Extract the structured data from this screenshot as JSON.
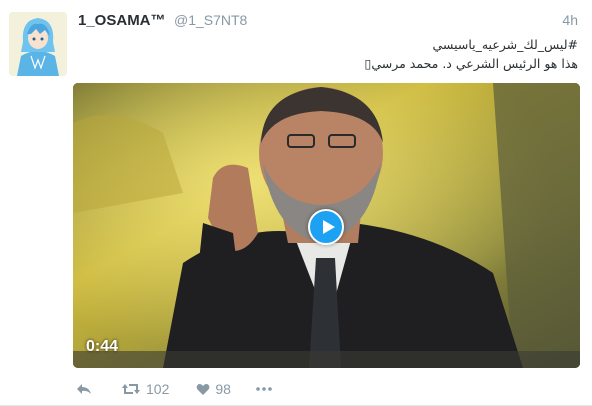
{
  "tweet": {
    "display_name": "1_OSAMA™",
    "handle": "@1_S7NT8",
    "time": "4h",
    "hashtag": "#ليس_لك_شرعيه_ياسيسي",
    "text": "هذا هو الرئيس الشرعي د. محمد مرسي▯"
  },
  "media": {
    "type": "video",
    "duration": "0:44",
    "play_icon": "play-icon",
    "accent": "#1da1f2"
  },
  "actions": {
    "reply_icon": "reply-icon",
    "retweet_count": "102",
    "like_count": "98",
    "more_icon": "more-icon"
  }
}
